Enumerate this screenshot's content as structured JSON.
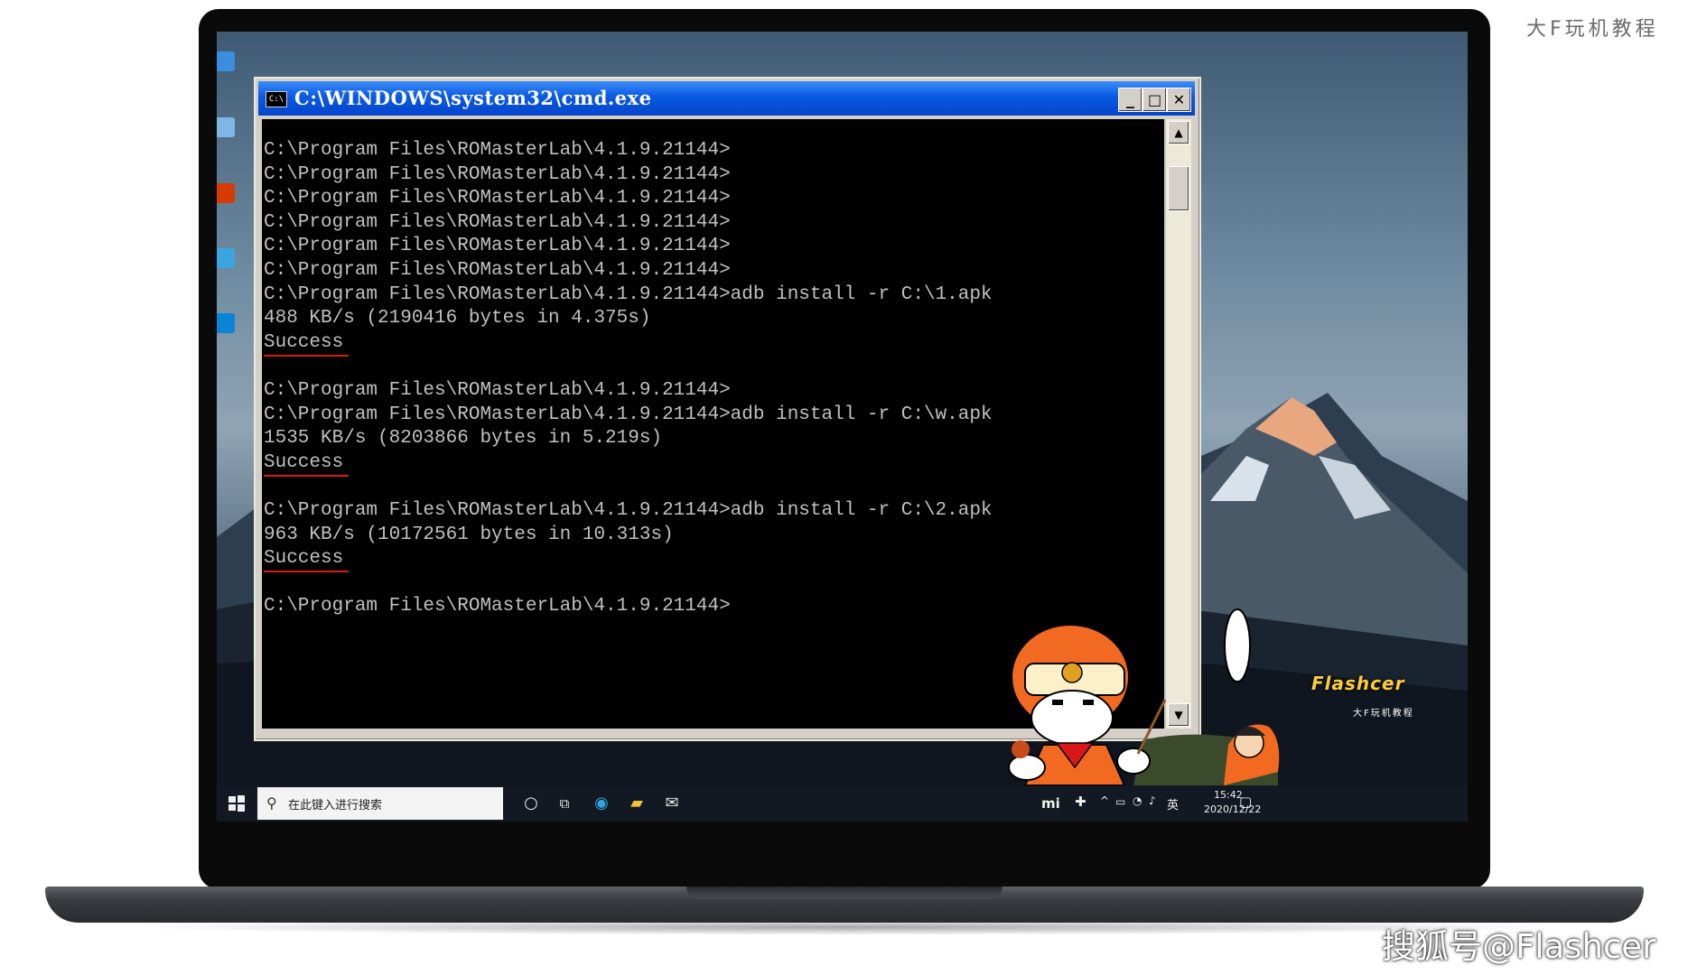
{
  "watermark_top": "大F玩机教程",
  "watermark_bottom": "搜狐号@Flashcer",
  "cmd_window": {
    "icon_text": "C:\\",
    "title": "C:\\WINDOWS\\system32\\cmd.exe",
    "minimize_glyph": "_",
    "maximize_glyph": "□",
    "close_glyph": "✕",
    "lines": [
      {
        "text": "C:\\Program Files\\ROMasterLab\\4.1.9.21144>",
        "underline": false
      },
      {
        "text": "C:\\Program Files\\ROMasterLab\\4.1.9.21144>",
        "underline": false
      },
      {
        "text": "C:\\Program Files\\ROMasterLab\\4.1.9.21144>",
        "underline": false
      },
      {
        "text": "C:\\Program Files\\ROMasterLab\\4.1.9.21144>",
        "underline": false
      },
      {
        "text": "C:\\Program Files\\ROMasterLab\\4.1.9.21144>",
        "underline": false
      },
      {
        "text": "C:\\Program Files\\ROMasterLab\\4.1.9.21144>",
        "underline": false
      },
      {
        "text": "C:\\Program Files\\ROMasterLab\\4.1.9.21144>adb install -r C:\\1.apk",
        "underline": false
      },
      {
        "text": "488 KB/s (2190416 bytes in 4.375s)",
        "underline": false
      },
      {
        "text": "Success",
        "underline": true
      },
      {
        "text": "",
        "underline": false
      },
      {
        "text": "C:\\Program Files\\ROMasterLab\\4.1.9.21144>",
        "underline": false
      },
      {
        "text": "C:\\Program Files\\ROMasterLab\\4.1.9.21144>adb install -r C:\\w.apk",
        "underline": false
      },
      {
        "text": "1535 KB/s (8203866 bytes in 5.219s)",
        "underline": false
      },
      {
        "text": "Success",
        "underline": true
      },
      {
        "text": "",
        "underline": false
      },
      {
        "text": "C:\\Program Files\\ROMasterLab\\4.1.9.21144>adb install -r C:\\2.apk",
        "underline": false
      },
      {
        "text": "963 KB/s (10172561 bytes in 10.313s)",
        "underline": false
      },
      {
        "text": "Success",
        "underline": true
      },
      {
        "text": "",
        "underline": false
      },
      {
        "text": "C:\\Program Files\\ROMasterLab\\4.1.9.21144>",
        "underline": false
      }
    ]
  },
  "mascot": {
    "name": "Flashcer",
    "subtitle": "大F玩机教程"
  },
  "taskbar": {
    "search_placeholder": "在此键入进行搜索",
    "tray": {
      "mi_label": "mi",
      "ime_label": "英",
      "time": "15:42",
      "date": "2020/12/22"
    }
  },
  "colors": {
    "titlebar": "#0a59e3",
    "console_bg": "#000000",
    "console_text": "#c0c0c0",
    "success_underline": "#d81818",
    "mascot_orange": "#f26a21"
  }
}
